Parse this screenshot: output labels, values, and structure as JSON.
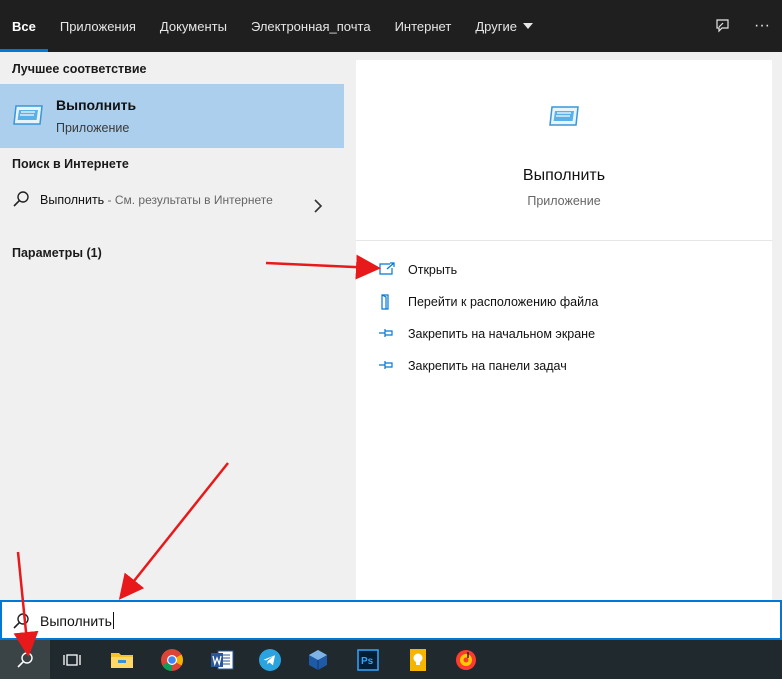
{
  "tabs": [
    {
      "label": "Все",
      "active": true
    },
    {
      "label": "Приложения"
    },
    {
      "label": "Документы"
    },
    {
      "label": "Электронная_почта"
    },
    {
      "label": "Интернет"
    },
    {
      "label": "Другие"
    }
  ],
  "top_icons": {
    "feedback": "feedback-icon",
    "more": "···"
  },
  "left": {
    "best_match_title": "Лучшее соответствие",
    "best_match": {
      "name": "Выполнить",
      "type": "Приложение",
      "icon": "run-app-icon"
    },
    "web_title": "Поиск в Интернете",
    "web_item": {
      "query": "Выполнить",
      "hint": " - См. результаты в Интернете"
    },
    "settings_title": "Параметры (1)"
  },
  "preview": {
    "title": "Выполнить",
    "subtitle": "Приложение",
    "actions": [
      {
        "label": "Открыть",
        "icon": "open-icon"
      },
      {
        "label": "Перейти к расположению файла",
        "icon": "file-location-icon"
      },
      {
        "label": "Закрепить на начальном экране",
        "icon": "pin-icon"
      },
      {
        "label": "Закрепить на панели задач",
        "icon": "pin-icon"
      }
    ]
  },
  "search": {
    "value": "Выполнить"
  },
  "taskbar": {
    "items": [
      "search-icon",
      "task-view-icon",
      "file-explorer-icon",
      "chrome-icon",
      "word-icon",
      "telegram-icon",
      "virtualbox-icon",
      "photoshop-icon",
      "keep-icon",
      "music-icon"
    ]
  },
  "colors": {
    "accent": "#0078d7",
    "selection": "#abcfed",
    "annotation": "#e8191b"
  }
}
